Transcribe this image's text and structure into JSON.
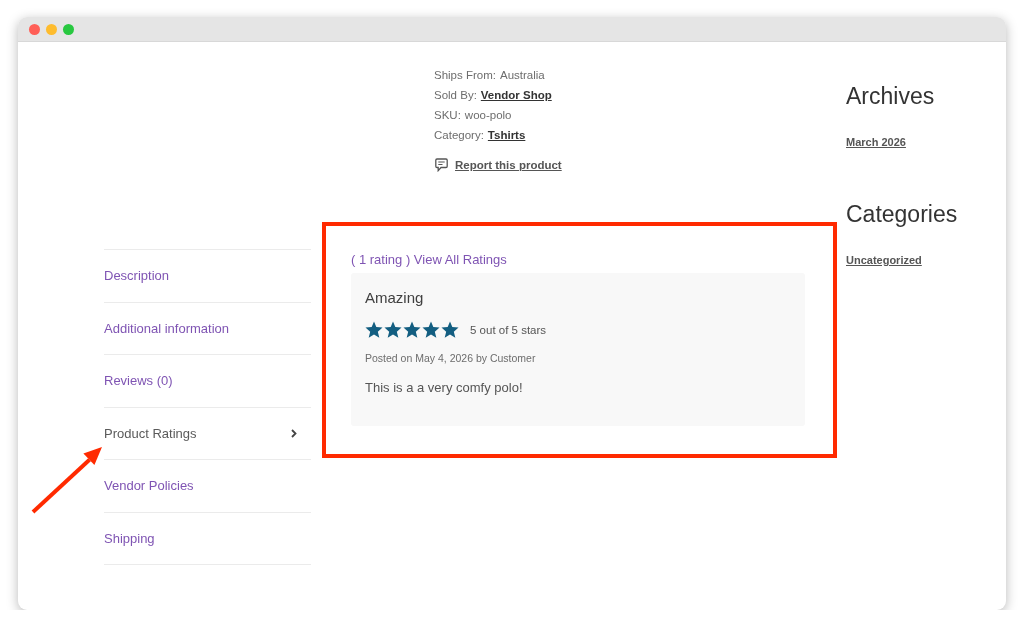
{
  "product_meta": [
    {
      "label": "Ships From:",
      "value": "Australia",
      "link": false
    },
    {
      "label": "Sold By:",
      "value": "Vendor Shop",
      "link": true
    },
    {
      "label": "SKU:",
      "value": "woo-polo",
      "link": false
    },
    {
      "label": "Category:",
      "value": "Tshirts",
      "link": true
    }
  ],
  "report_link": {
    "text": "Report this product"
  },
  "tabs": [
    {
      "label": "Description",
      "selected": false
    },
    {
      "label": "Additional information",
      "selected": false
    },
    {
      "label": "Reviews (0)",
      "selected": false
    },
    {
      "label": "Product Ratings",
      "selected": true
    },
    {
      "label": "Vendor Policies",
      "selected": false
    },
    {
      "label": "Shipping",
      "selected": false
    }
  ],
  "ratings_panel": {
    "summary_link": "( 1 rating ) View All Ratings",
    "reviews": [
      {
        "title": "Amazing",
        "stars": 5,
        "stars_text": "5 out of 5 stars",
        "posted": "Posted on May 4, 2026 by Customer",
        "comment": "This is a a very comfy polo!"
      }
    ]
  },
  "sidebar": {
    "widgets": [
      {
        "title": "Archives",
        "links": [
          "March 2026"
        ]
      },
      {
        "title": "Categories",
        "links": [
          "Uncategorized"
        ]
      }
    ]
  }
}
